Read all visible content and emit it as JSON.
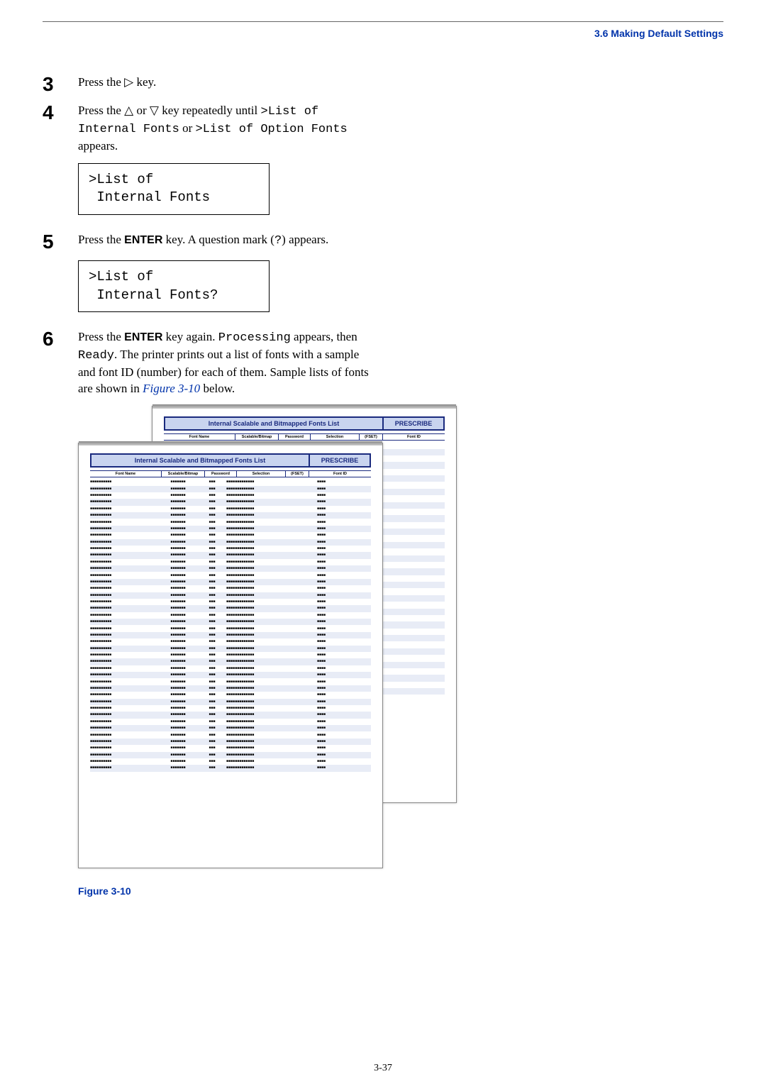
{
  "section_link": "3.6 Making Default Settings",
  "steps": {
    "s3": {
      "num": "3",
      "text_before": "Press the ",
      "symbol": "▷",
      "text_after": " key."
    },
    "s4": {
      "num": "4",
      "text_before": "Press the  ",
      "sym1": "△",
      "mid": " or ",
      "sym2": "▽",
      "text_after1": " key repeatedly until ",
      "mono1": ">List of Internal Fonts",
      "or": " or ",
      "mono2": ">List of Option Fonts",
      "appears": " appears."
    },
    "s5": {
      "num": "5",
      "text_before": "Press the ",
      "bold": "ENTER",
      "text_after": " key. A question mark (",
      "mono": "?",
      "tail": ") appears."
    },
    "s6": {
      "num": "6",
      "text1": "Press the ",
      "bold": "ENTER",
      "text2": " key again. ",
      "mono1": "Processing",
      "text3": " appears, then ",
      "mono2": "Ready",
      "text4": ". The printer prints out a list of fonts with a sample and font ID (number) for each of them. Sample lists of fonts are shown in ",
      "figlink": "Figure 3-10",
      "text5": " below."
    }
  },
  "lcd1": ">List of\n Internal Fonts",
  "lcd2": ">List of\n Internal Fonts?",
  "report": {
    "title": "Internal Scalable and Bitmapped Fonts List",
    "brand": "PRESCRIBE",
    "headers": {
      "font_name": "Font Name",
      "scalable_bitmap": "Scalable/Bitmap",
      "password": "Password",
      "selection": "Selection",
      "pset": "(FSET)",
      "font_id": "Font ID"
    },
    "placeholder_long": "■■■■■■■■■■",
    "placeholder_med": "■■■■■■■",
    "placeholder_pw": "■■■",
    "placeholder_sel": "■■■■■■■■■■■■■",
    "placeholder_id": "■■■■",
    "front_row_count": 44,
    "back_row_count": 38
  },
  "figure_caption": "Figure 3-10",
  "page_number": "3-37"
}
